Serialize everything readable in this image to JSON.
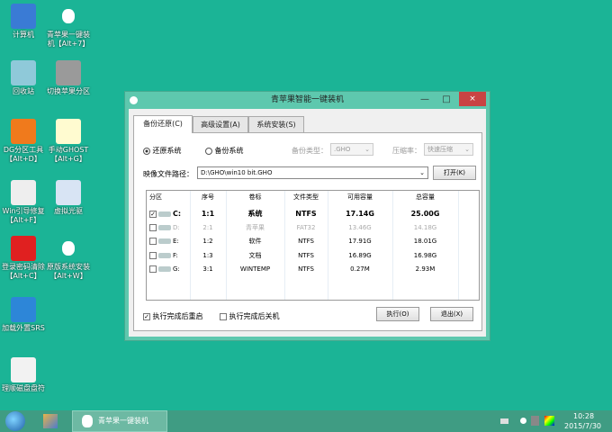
{
  "desktop": {
    "icons": [
      {
        "label": "计算机",
        "icon": "computer-icon",
        "color": "#3a7bd5"
      },
      {
        "label": "青苹果一键装机【Alt+7】",
        "icon": "apple-icon",
        "color": "#ffffff"
      },
      {
        "label": "回收站",
        "icon": "recycle-bin-icon",
        "color": "#8fc9d9"
      },
      {
        "label": "切换苹果分区",
        "icon": "hard-drive-icon",
        "color": "#9a9a9a"
      },
      {
        "label": "DG分区工具【Alt+D】",
        "icon": "diskgenius-icon",
        "color": "#f07a1c"
      },
      {
        "label": "手动GHOST【Alt+G】",
        "icon": "ghost-icon",
        "color": "#fffbd0"
      },
      {
        "label": "Win引导修复【Alt+F】",
        "icon": "toolbox-icon",
        "color": "#eeeeee"
      },
      {
        "label": "虚拟光驱",
        "icon": "virtual-cd-icon",
        "color": "#d8e4f4"
      },
      {
        "label": "登录密码清除【Alt+C】",
        "icon": "nt-key-icon",
        "color": "#e02020"
      },
      {
        "label": "原版系统安装【Alt+W】",
        "icon": "apple-icon",
        "color": "#ffffff"
      },
      {
        "label": "加载外置SRS",
        "icon": "firewire-icon",
        "color": "#2d86d8"
      },
      {
        "label": "理顺磁盘盘符",
        "icon": "swap-drive-icon",
        "color": "#f2f2f2"
      }
    ]
  },
  "window": {
    "title": "青苹果智能一键装机",
    "minimize": "—",
    "maximize": "□",
    "close": "×",
    "tabs": [
      "备份还原(C)",
      "高级设置(A)",
      "系统安装(S)"
    ],
    "restore_radio": "还原系统",
    "backup_radio": "备份系统",
    "backup_type_label": "备份类型：",
    "backup_type_value": ".GHO",
    "compress_label": "压缩率：",
    "compress_value": "快速压缩",
    "image_path_label": "映像文件路径：",
    "image_path_value": "D:\\GHO\\win10 bit.GHO",
    "open_button": "打开(K)",
    "table": {
      "headers": [
        "分区",
        "序号",
        "卷标",
        "文件类型",
        "可用容量",
        "总容量"
      ],
      "rows": [
        {
          "checked": true,
          "drive": "C:",
          "index": "1:1",
          "label": "系统",
          "fs": "NTFS",
          "free": "17.14G",
          "total": "25.00G",
          "style": "bold"
        },
        {
          "checked": false,
          "drive": "D:",
          "index": "2:1",
          "label": "青苹果",
          "fs": "FAT32",
          "free": "13.46G",
          "total": "14.18G",
          "style": "gray"
        },
        {
          "checked": false,
          "drive": "E:",
          "index": "1:2",
          "label": "软件",
          "fs": "NTFS",
          "free": "17.91G",
          "total": "18.01G",
          "style": "normal"
        },
        {
          "checked": false,
          "drive": "F:",
          "index": "1:3",
          "label": "文档",
          "fs": "NTFS",
          "free": "16.89G",
          "total": "16.98G",
          "style": "normal"
        },
        {
          "checked": false,
          "drive": "G:",
          "index": "3:1",
          "label": "WINTEMP",
          "fs": "NTFS",
          "free": "0.27M",
          "total": "2.93M",
          "style": "normal"
        }
      ]
    },
    "reboot_check": "执行完成后重启",
    "reboot_checked": true,
    "shutdown_check": "执行完成后关机",
    "shutdown_checked": false,
    "execute_button": "执行(O)",
    "exit_button": "退出(X)"
  },
  "taskbar": {
    "app_label": "青苹果一键装机",
    "time": "10:28",
    "date": "2015/7/30"
  }
}
